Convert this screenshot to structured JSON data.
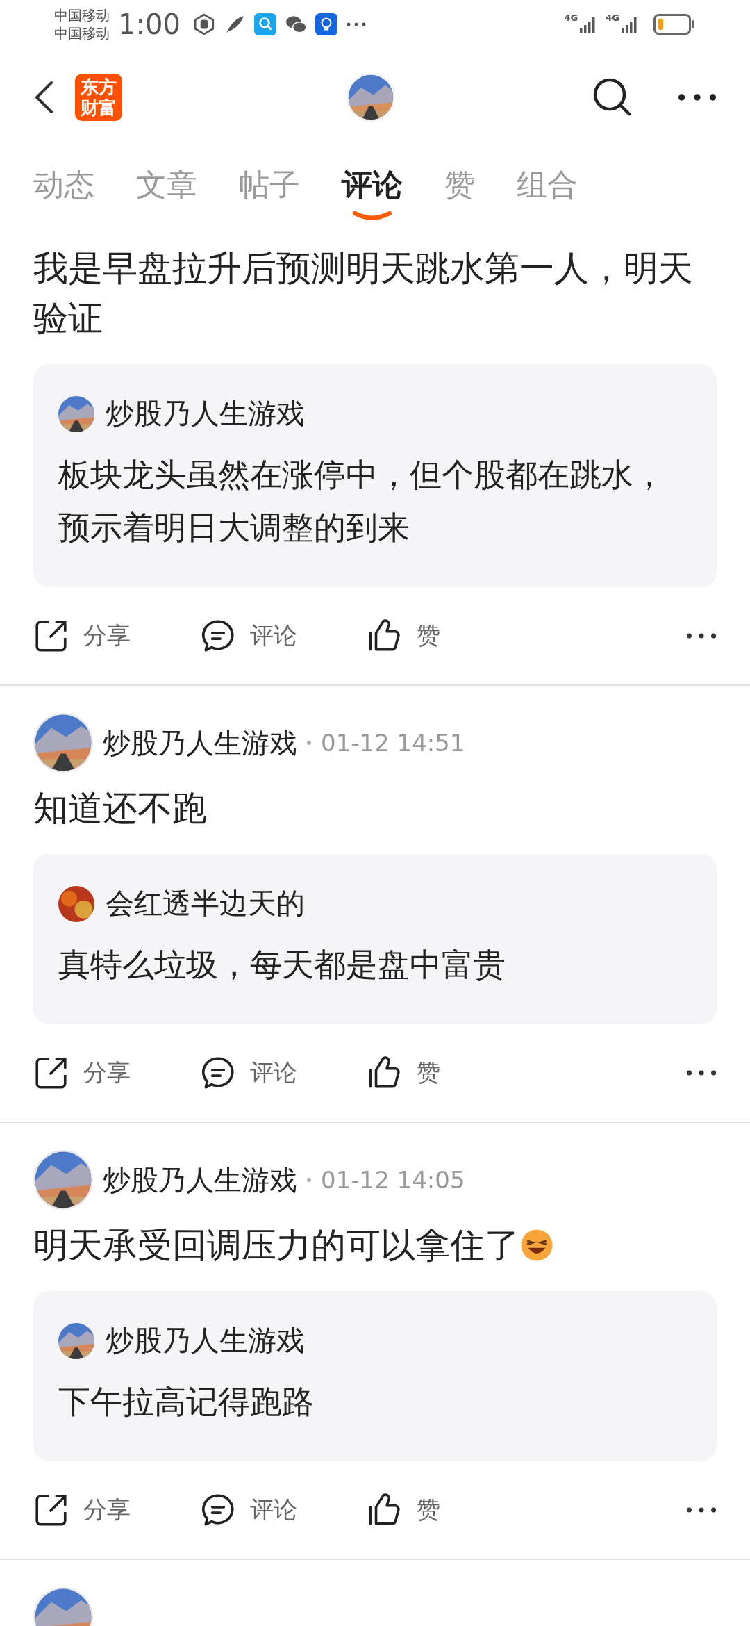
{
  "status_bar": {
    "carriers": [
      "中国移动",
      "中国移动"
    ],
    "time": "1:00",
    "networks": [
      "4G",
      "4G"
    ]
  },
  "header": {
    "logo": "东方财富"
  },
  "tabs": [
    {
      "label": "动态",
      "selected": false
    },
    {
      "label": "文章",
      "selected": false
    },
    {
      "label": "帖子",
      "selected": false
    },
    {
      "label": "评论",
      "selected": true
    },
    {
      "label": "赞",
      "selected": false
    },
    {
      "label": "组合",
      "selected": false
    }
  ],
  "posts": [
    {
      "text": "我是早盘拉升后预测明天跳水第一人，明天验证",
      "quote": {
        "author": "炒股乃人生游戏",
        "avatar": {
          "kind": "road"
        },
        "text": "板块龙头虽然在涨停中，但个股都在跳水，预示着明日大调整的到来"
      },
      "actions": [
        "分享",
        "评论",
        "赞"
      ]
    },
    {
      "author": "炒股乃人生游戏",
      "avatar": {
        "kind": "road"
      },
      "time": "01-12 14:51",
      "text": "知道还不跑",
      "quote": {
        "author": "会红透半边天的",
        "avatar": {
          "kind": "foliage"
        },
        "text": "真特么垃圾，每天都是盘中富贵"
      },
      "actions": [
        "分享",
        "评论",
        "赞"
      ]
    },
    {
      "author": "炒股乃人生游戏",
      "avatar": {
        "kind": "road"
      },
      "time": "01-12 14:05",
      "text": "明天承受回调压力的可以拿住了",
      "trailing_emoji": true,
      "quote": {
        "author": "炒股乃人生游戏",
        "avatar": {
          "kind": "road"
        },
        "text": "下午拉高记得跑路"
      },
      "actions": [
        "分享",
        "评论",
        "赞"
      ]
    },
    {
      "avatar": {
        "kind": "road"
      }
    }
  ]
}
